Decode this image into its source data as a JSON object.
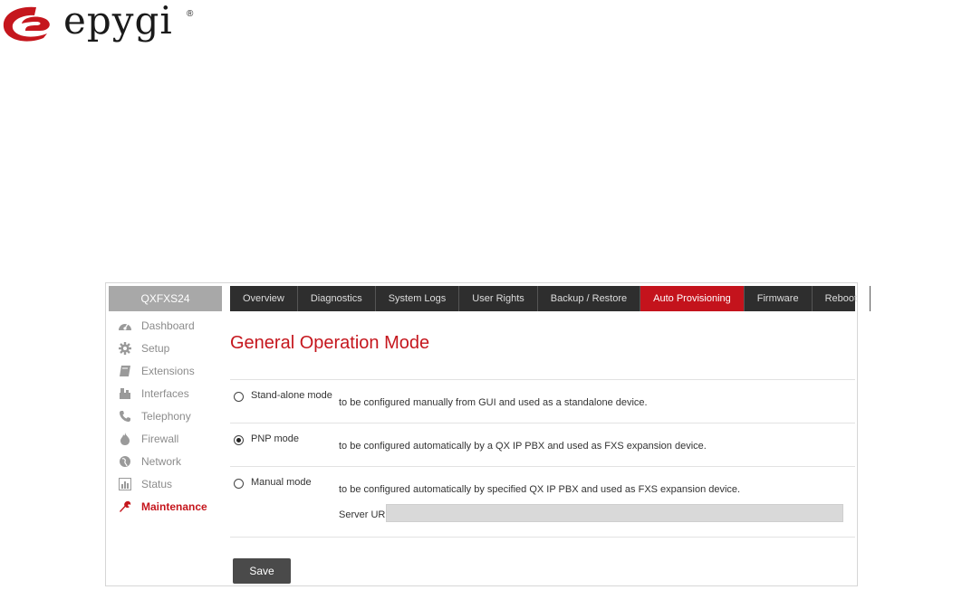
{
  "brand": {
    "logo_text": "epygi",
    "registered_mark": "®"
  },
  "device": {
    "name": "QXFXS24"
  },
  "sidebar": {
    "items": [
      {
        "label": "Dashboard",
        "icon": "dashboard-icon"
      },
      {
        "label": "Setup",
        "icon": "gear-icon"
      },
      {
        "label": "Extensions",
        "icon": "book-icon"
      },
      {
        "label": "Interfaces",
        "icon": "interfaces-icon"
      },
      {
        "label": "Telephony",
        "icon": "phone-icon"
      },
      {
        "label": "Firewall",
        "icon": "flame-icon"
      },
      {
        "label": "Network",
        "icon": "globe-icon"
      },
      {
        "label": "Status",
        "icon": "bar-chart-icon"
      },
      {
        "label": "Maintenance",
        "icon": "wrench-icon",
        "active": true
      }
    ]
  },
  "tabs": [
    {
      "label": "Overview"
    },
    {
      "label": "Diagnostics"
    },
    {
      "label": "System Logs"
    },
    {
      "label": "User Rights"
    },
    {
      "label": "Backup / Restore"
    },
    {
      "label": "Auto Provisioning",
      "active": true
    },
    {
      "label": "Firmware"
    },
    {
      "label": "Reboot"
    }
  ],
  "page": {
    "title": "General Operation Mode"
  },
  "modes": [
    {
      "label": "Stand-alone mode",
      "description": "to be configured manually from GUI and used as a standalone device.",
      "selected": false
    },
    {
      "label": "PNP mode",
      "description": "to be configured automatically by a QX IP PBX and used as FXS expansion device.",
      "selected": true
    },
    {
      "label": "Manual mode",
      "description": "to be configured automatically by specified QX IP PBX and used as FXS expansion device.",
      "selected": false
    }
  ],
  "server_url": {
    "label": "Server URL",
    "value": ""
  },
  "actions": {
    "save_label": "Save"
  },
  "colors": {
    "accent": "#c5161d",
    "tab_bar": "#2e2e2e",
    "active_tab": "#c4131c",
    "sidebar_text": "#8c8c8c"
  }
}
